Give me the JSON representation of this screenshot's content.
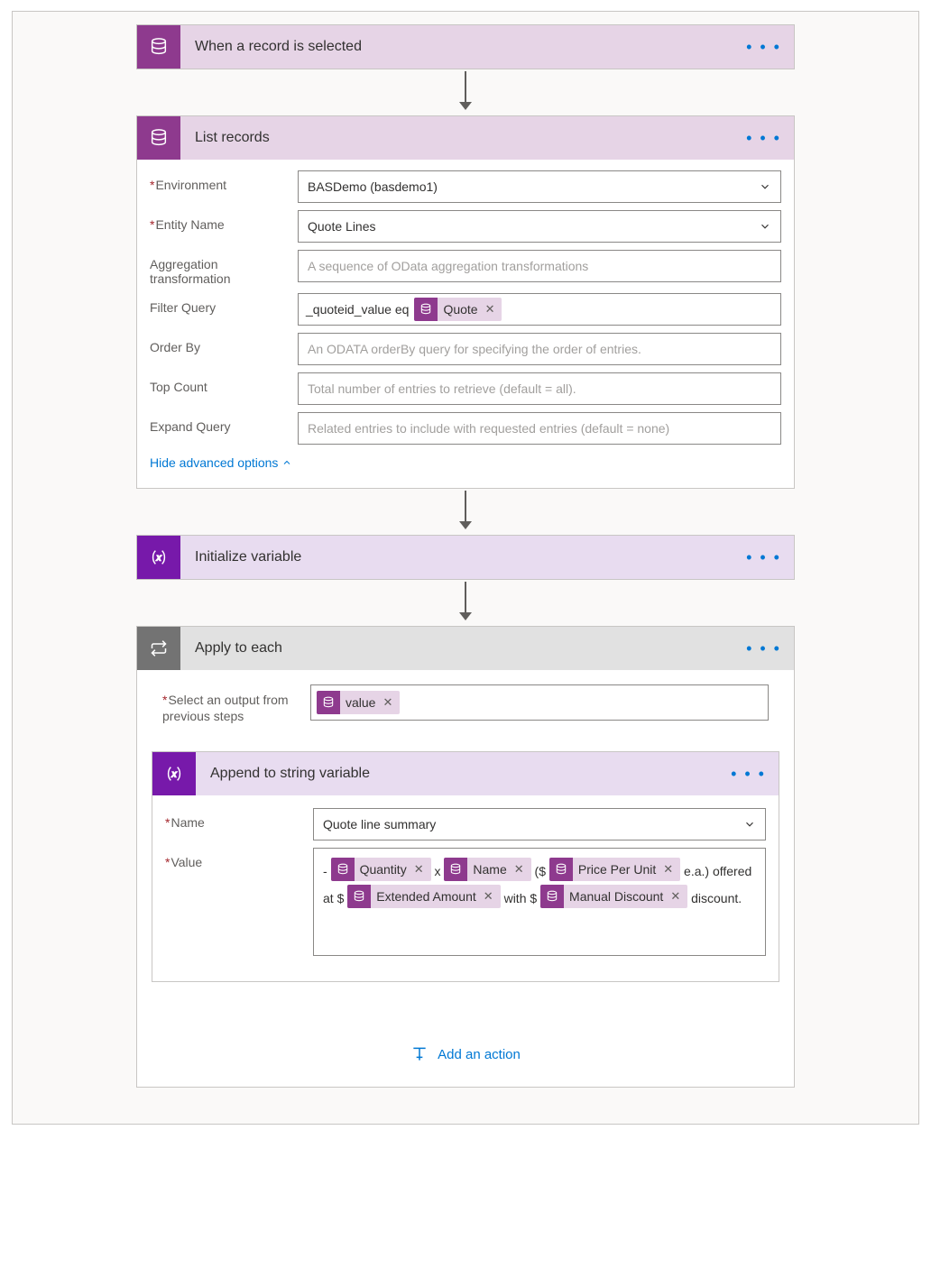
{
  "steps": {
    "trigger": {
      "title": "When a record is selected"
    },
    "list": {
      "title": "List records",
      "labels": {
        "env": "Environment",
        "entity": "Entity Name",
        "agg": "Aggregation transformation",
        "filter": "Filter Query",
        "order": "Order By",
        "top": "Top Count",
        "expand": "Expand Query"
      },
      "values": {
        "env": "BASDemo (basdemo1)",
        "entity": "Quote Lines"
      },
      "filter_prefix": "_quoteid_value eq",
      "filter_token": "Quote",
      "placeholders": {
        "agg": "A sequence of OData aggregation transformations",
        "order": "An ODATA orderBy query for specifying the order of entries.",
        "top": "Total number of entries to retrieve (default = all).",
        "expand": "Related entries to include with requested entries (default = none)"
      },
      "hide_link": "Hide advanced options"
    },
    "init": {
      "title": "Initialize variable"
    },
    "apply": {
      "title": "Apply to each",
      "select_label": "Select an output from previous steps",
      "select_token": "value",
      "append": {
        "title": "Append to string variable",
        "name_label": "Name",
        "name_value": "Quote line summary",
        "value_label": "Value",
        "text": {
          "dash": "-",
          "x": "x",
          "open": "($",
          "ea": "e.a.)",
          "offered": "offered at $",
          "with": "with $",
          "disc": "discount."
        },
        "tokens": {
          "qty": "Quantity",
          "name": "Name",
          "ppu": "Price Per Unit",
          "ext": "Extended Amount",
          "md": "Manual Discount"
        }
      }
    },
    "add_action": "Add an action"
  }
}
